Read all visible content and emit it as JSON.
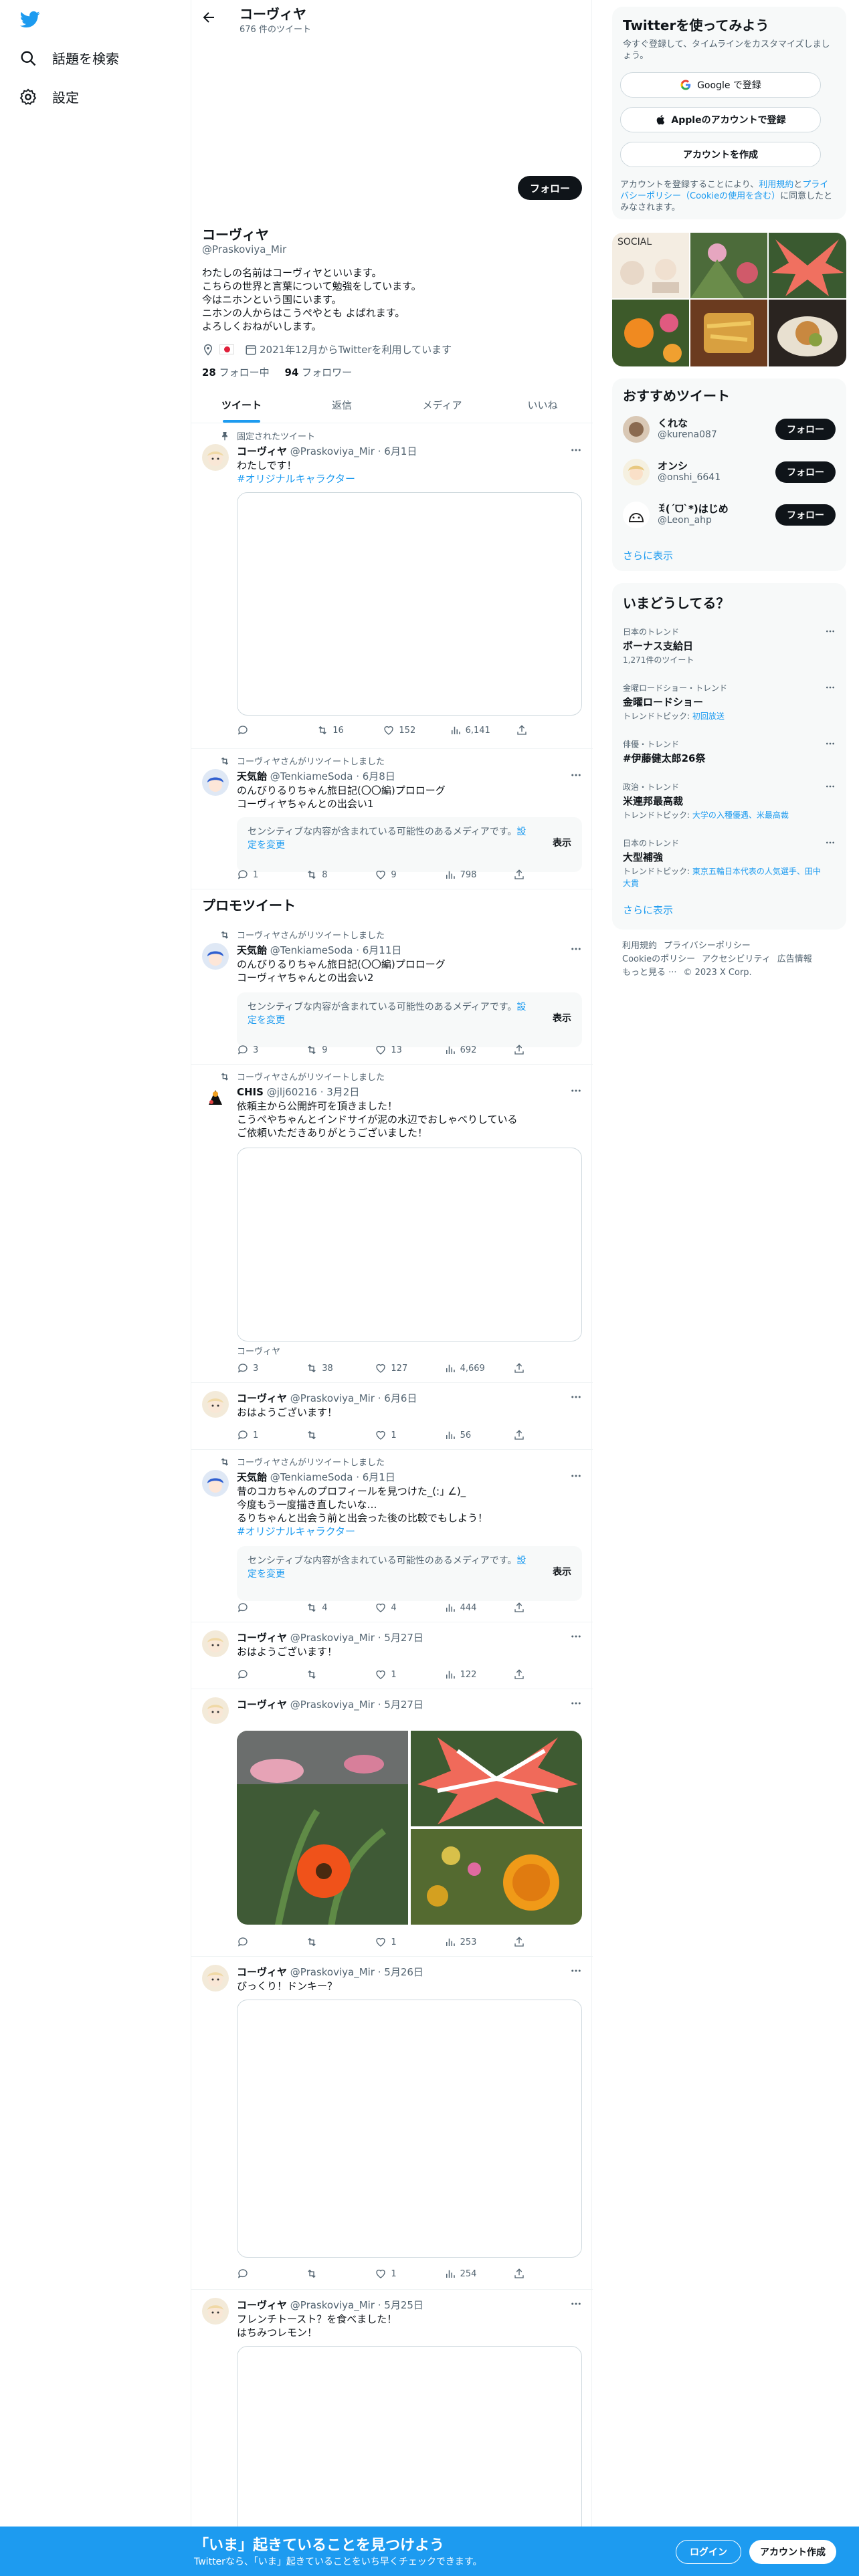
{
  "nav": {
    "explore": "話題を検索",
    "settings": "設定"
  },
  "header": {
    "title": "コーヴィヤ",
    "subtitle": "676 件のツイート"
  },
  "profile": {
    "follow_label": "フォロー",
    "name": "コーヴィヤ",
    "handle": "@Praskoviya_Mir",
    "bio": [
      "わたしの名前はコーヴィヤといいます。",
      "こちらの世界と言葉について勉強をしています。",
      "今はニホンという国にいます。",
      "ニホンの人からはこうぺやとも よばれます。",
      "よろしくおねがいします。"
    ],
    "joined": "2021年12月からTwitterを利用しています",
    "following_count": "28",
    "following_label": "フォロー中",
    "followers_count": "94",
    "followers_label": "フォロワー"
  },
  "tabs": [
    "ツイート",
    "返信",
    "メディア",
    "いいね"
  ],
  "tweets": {
    "pinned_label": "固定されたツイート",
    "retweet_label": "コーヴィヤさんがリツイートしました",
    "promo_heading": "プロモツイート",
    "sensitive_text": "センシティブな内容が含まれている可能性のあるメディアです。",
    "sensitive_link": "設定を変更",
    "sensitive_button": "表示",
    "t1": {
      "name": "コーヴィヤ",
      "handle": "@Praskoviya_Mir · 6月1日",
      "text": "わたしです！",
      "hashtag": "#オリジナルキャラクター",
      "rt": "16",
      "like": "152",
      "views": "6,141"
    },
    "t2": {
      "name": "天気飴",
      "handle": "@TenkiameSoda · 6月8日",
      "text": [
        "のんびりるりちゃん旅日記(〇〇編)プロローグ",
        "コーヴィヤちゃんとの出会い1"
      ],
      "reply": "1",
      "rt": "8",
      "like": "9",
      "views": "798"
    },
    "t3": {
      "name": "天気飴",
      "handle": "@TenkiameSoda · 6月11日",
      "text": [
        "のんびりるりちゃん旅日記(〇〇編)プロローグ",
        "コーヴィヤちゃんとの出会い2"
      ],
      "reply": "3",
      "rt": "9",
      "like": "13",
      "views": "692"
    },
    "t4": {
      "name": "CHIS",
      "handle": "@jlj60216 · 3月2日",
      "text": [
        "依頼主から公開許可を頂きました！",
        "こうぺやちゃんとインドサイが泥の水辺でおしゃべりしている",
        "ご依頼いただきありがとうございました！"
      ],
      "caption": "コーヴィヤ",
      "reply": "3",
      "rt": "38",
      "like": "127",
      "views": "4,669"
    },
    "t5": {
      "name": "コーヴィヤ",
      "handle": "@Praskoviya_Mir · 6月6日",
      "text": "おはようございます！",
      "reply": "1",
      "like": "1",
      "views": "56"
    },
    "t6": {
      "name": "天気飴",
      "handle": "@TenkiameSoda · 6月1日",
      "text": [
        "昔のコカちゃんのプロフィールを見つけた_(:｣ ∠)_",
        "今度もう一度描き直したいな…",
        "るりちゃんと出会う前と出会った後の比較でもしよう！"
      ],
      "hashtag": "#オリジナルキャラクター",
      "rt": "4",
      "like": "4",
      "views": "444"
    },
    "t7": {
      "name": "コーヴィヤ",
      "handle": "@Praskoviya_Mir · 5月27日",
      "text": "おはようございます！",
      "like": "1",
      "views": "122"
    },
    "t8": {
      "name": "コーヴィヤ",
      "handle": "@Praskoviya_Mir · 5月27日",
      "like": "1",
      "views": "253"
    },
    "t9": {
      "name": "コーヴィヤ",
      "handle": "@Praskoviya_Mir · 5月26日",
      "text": "びっくり！ドンキー？",
      "like": "1",
      "views": "254"
    },
    "t10": {
      "name": "コーヴィヤ",
      "handle": "@Praskoviya_Mir · 5月25日",
      "text": [
        "フレンチトースト？を食べました！",
        "はちみつレモン！"
      ]
    }
  },
  "signup": {
    "title": "Twitterを使ってみよう",
    "subtitle": "今すぐ登録して、タイムラインをカスタマイズしましょう。",
    "google": "Google で登録",
    "apple": "Appleのアカウントで登録",
    "create": "アカウントを作成",
    "legal_1": "アカウントを登録することにより、",
    "legal_link1": "利用規約",
    "legal_2": "と",
    "legal_link2": "プライバシーポリシー（Cookieの使用を含む）",
    "legal_3": "に同意したとみなされます。"
  },
  "recommend": {
    "title": "おすすめツイート",
    "follow_label": "フォロー",
    "users": [
      {
        "name": "くれな",
        "handle": "@kurena087"
      },
      {
        "name": "オンシ",
        "handle": "@onshi_6641"
      },
      {
        "name": "ꉂ(ˊᗜˋ*)はじめ",
        "handle": "@Leon_ahp"
      }
    ],
    "more": "さらに表示"
  },
  "trends": {
    "title": "いまどうしてる？",
    "items": [
      {
        "context": "日本のトレンド",
        "topic": "ボーナス支給日",
        "extra": "1,271件のツイート",
        "extra_link": ""
      },
      {
        "context": "金曜ロードショー・トレンド",
        "topic": "金曜ロードショー",
        "extra": "トレンドトピック: ",
        "extra_link": "初回放送"
      },
      {
        "context": "俳優・トレンド",
        "topic": "#伊藤健太郎26祭",
        "extra": "",
        "extra_link": ""
      },
      {
        "context": "政治・トレンド",
        "topic": "米連邦最高裁",
        "extra": "トレンドトピック: ",
        "extra_link": "大学の入種優遇、米最高裁"
      },
      {
        "context": "日本のトレンド",
        "topic": "大型補強",
        "extra": "トレンドトピック: ",
        "extra_link": "東京五輪日本代表の人気選手、田中大貴"
      }
    ],
    "more": "さらに表示"
  },
  "footer": {
    "links": [
      "利用規約",
      "プライバシーポリシー",
      "Cookieのポリシー",
      "アクセシビリティ",
      "広告情報",
      "もっと見る ···",
      "© 2023 X Corp."
    ]
  },
  "bottom": {
    "title": "「いま」起きていることを見つけよう",
    "subtitle": "Twitterなら、「いま」起きていることをいち早くチェックできます。",
    "login": "ログイン",
    "signup": "アカウント作成"
  }
}
